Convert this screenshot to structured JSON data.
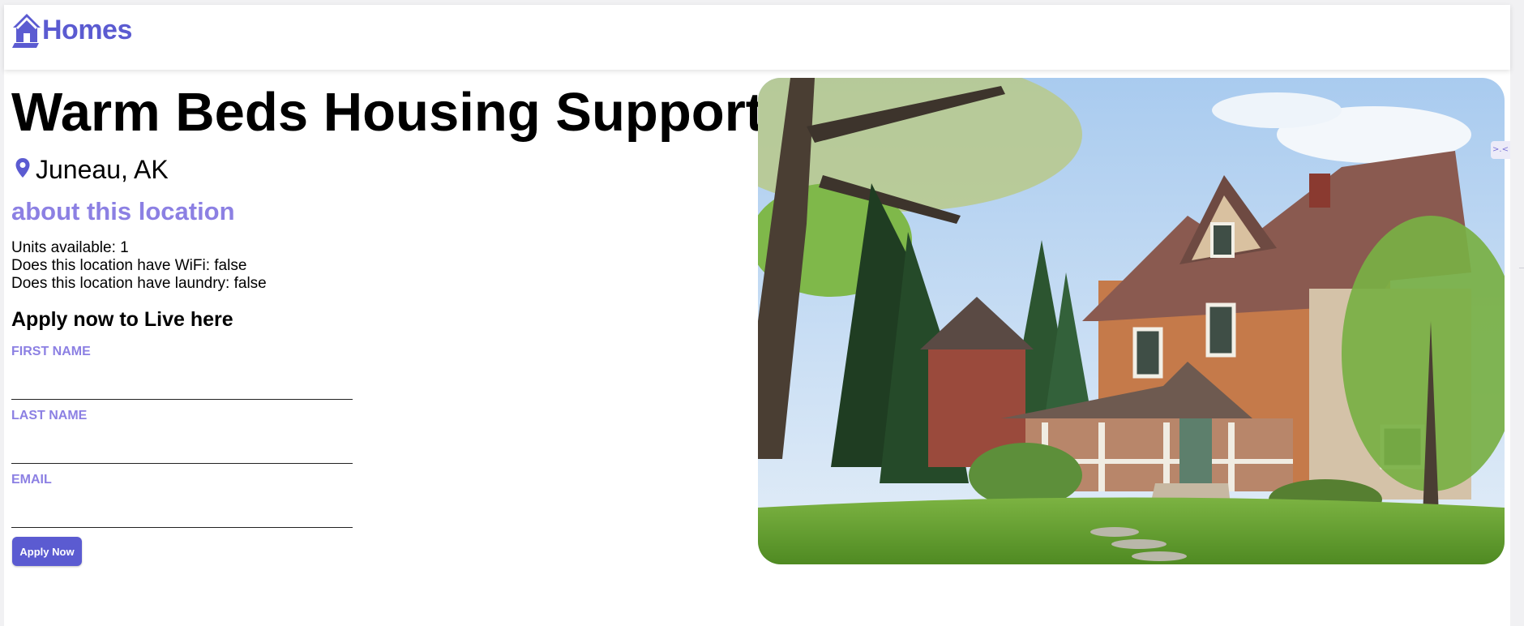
{
  "header": {
    "brand": "Homes",
    "logo_icon": "house-icon"
  },
  "listing": {
    "title": "Warm Beds Housing Support",
    "location_icon": "map-pin-icon",
    "location": "Juneau, AK",
    "about_heading": "about this location",
    "facts": [
      "Units available: 1",
      "Does this location have WiFi: false",
      "Does this location have laundry: false"
    ],
    "photo_subject": "house-photo"
  },
  "application": {
    "heading": "Apply now to Live here",
    "first_name_label": "FIRST NAME",
    "first_name_value": "",
    "last_name_label": "LAST NAME",
    "last_name_value": "",
    "email_label": "EMAIL",
    "email_value": "",
    "submit_label": "Apply Now"
  },
  "side_toggle": {
    "label": ">.<"
  },
  "colors": {
    "brand": "#5b5bd1",
    "accent_light": "#8c80e3",
    "button_text": "#ffffff"
  }
}
